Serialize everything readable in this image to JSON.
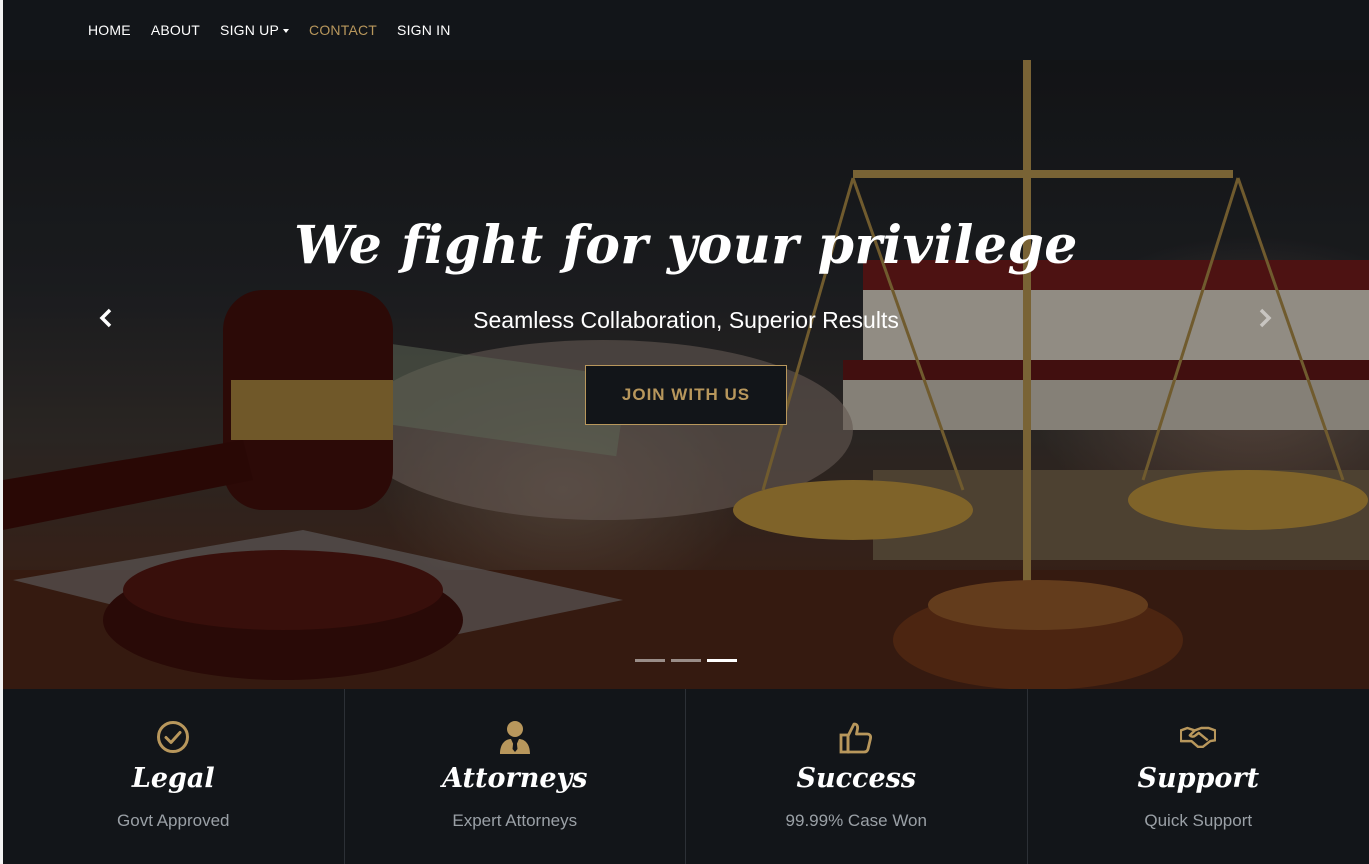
{
  "nav": {
    "items": [
      {
        "label": "HOME"
      },
      {
        "label": "ABOUT"
      },
      {
        "label": "SIGN UP"
      },
      {
        "label": "CONTACT"
      },
      {
        "label": "SIGN IN"
      }
    ]
  },
  "hero": {
    "title": "We fight for your privilege",
    "subtitle": "Seamless Collaboration, Superior Results",
    "button_label": "JOIN WITH US",
    "slide_count": 3,
    "active_slide": 3
  },
  "features": [
    {
      "icon": "check-circle-icon",
      "title": "Legal",
      "subtitle": "Govt Approved"
    },
    {
      "icon": "user-tie-icon",
      "title": "Attorneys",
      "subtitle": "Expert Attorneys"
    },
    {
      "icon": "thumbs-up-icon",
      "title": "Success",
      "subtitle": "99.99% Case Won"
    },
    {
      "icon": "handshake-icon",
      "title": "Support",
      "subtitle": "Quick Support"
    }
  ],
  "colors": {
    "accent": "#b8975c",
    "dark": "#121519",
    "text_light": "#ffffff",
    "text_muted": "#9aa0a6"
  }
}
